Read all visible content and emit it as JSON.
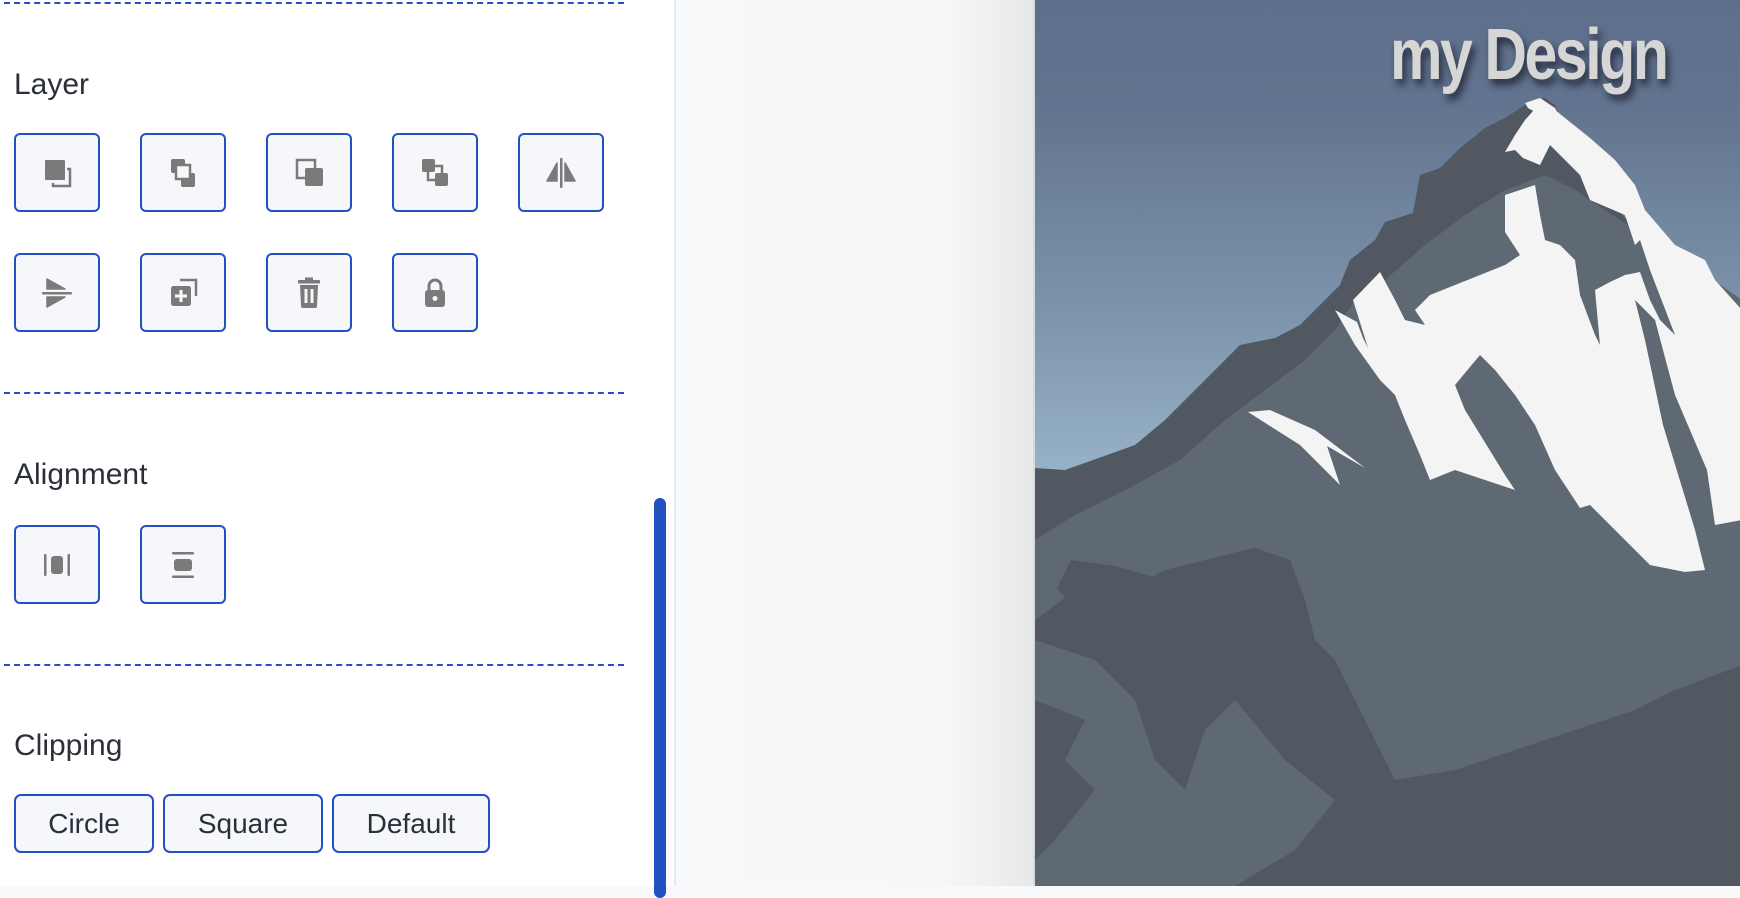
{
  "panel": {
    "sections": {
      "layer": {
        "title": "Layer",
        "buttons": [
          {
            "name": "send-to-back",
            "icon": "send-to-back-icon"
          },
          {
            "name": "send-backward",
            "icon": "send-backward-icon"
          },
          {
            "name": "bring-forward",
            "icon": "bring-forward-icon"
          },
          {
            "name": "bring-to-front",
            "icon": "bring-to-front-icon"
          },
          {
            "name": "flip-horizontal",
            "icon": "flip-horizontal-icon"
          },
          {
            "name": "flip-vertical",
            "icon": "flip-vertical-icon"
          },
          {
            "name": "duplicate",
            "icon": "duplicate-icon"
          },
          {
            "name": "delete",
            "icon": "trash-icon"
          },
          {
            "name": "lock",
            "icon": "lock-icon"
          }
        ]
      },
      "alignment": {
        "title": "Alignment",
        "buttons": [
          {
            "name": "align-horizontal-center",
            "icon": "align-horizontal-center-icon"
          },
          {
            "name": "align-vertical-center",
            "icon": "align-vertical-center-icon"
          }
        ]
      },
      "clipping": {
        "title": "Clipping",
        "buttons": [
          {
            "label": "Circle"
          },
          {
            "label": "Square"
          },
          {
            "label": "Default"
          }
        ]
      }
    }
  },
  "canvas": {
    "design_title": "my Design",
    "image_subject": "mountain-illustration"
  },
  "colors": {
    "accent": "#2151c3",
    "icon": "#7a7a7a",
    "text": "#2b2f3a",
    "button_bg": "#f5f7fa"
  }
}
